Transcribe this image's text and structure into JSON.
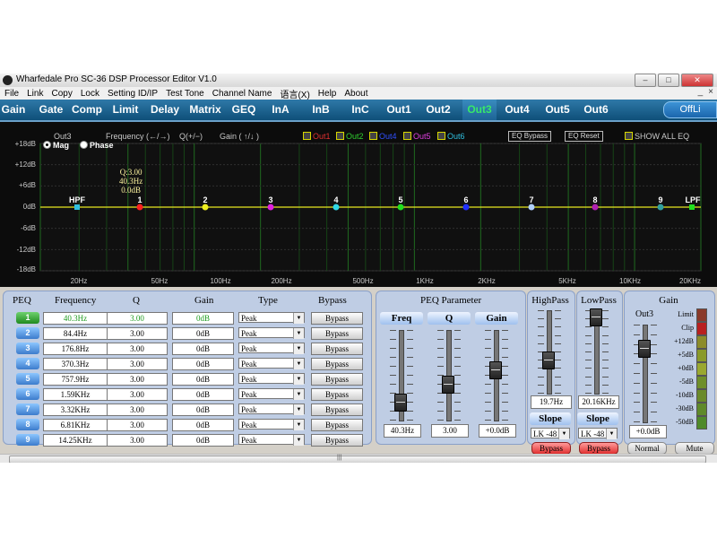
{
  "window": {
    "title": "Wharfedale Pro SC-36 DSP Processor Editor V1.0",
    "buttons": [
      "–",
      "□",
      "✕"
    ],
    "mdi_buttons": [
      "_",
      "×"
    ]
  },
  "menu": [
    "File",
    "Link",
    "Copy",
    "Lock",
    "Setting ID/IP",
    "Test Tone",
    "Channel Name",
    "语言(X)",
    "Help",
    "About"
  ],
  "tabs": [
    "Gain",
    "Gate",
    "Comp",
    "Limit",
    "Delay",
    "Matrix",
    "GEQ",
    "InA",
    "InB",
    "InC",
    "Out1",
    "Out2",
    "Out3",
    "Out4",
    "Out5",
    "Out6"
  ],
  "active_tab": "Out3",
  "status_button": "OffLi",
  "graph": {
    "channel": "Out3",
    "hint_frequency": "Frequency  (←/→)",
    "hint_q": "Q(+/−)",
    "hint_gain": "Gain ( ↑/↓ )",
    "legend": [
      {
        "name": "Out1",
        "color": "#e03030"
      },
      {
        "name": "Out2",
        "color": "#30d030"
      },
      {
        "name": "Out4",
        "color": "#3050ff"
      },
      {
        "name": "Out5",
        "color": "#e040e0"
      },
      {
        "name": "Out6",
        "color": "#30c0e0"
      }
    ],
    "eq_bypass": "EQ Bypass",
    "eq_reset": "EQ Reset",
    "show_all_eq": "SHOW ALL EQ",
    "mode_mag": "Mag",
    "mode_phase": "Phase",
    "y_ticks": [
      "+18dB",
      "+12dB",
      "+6dB",
      "0dB",
      "-6dB",
      "-12dB",
      "-18dB"
    ],
    "x_ticks": [
      "20Hz",
      "50Hz",
      "100Hz",
      "200Hz",
      "500Hz",
      "1KHz",
      "2KHz",
      "5KHz",
      "10KHz",
      "20KHz"
    ],
    "q_info": [
      "Q:3.00",
      "40.3Hz",
      "0.0dB"
    ],
    "points": [
      {
        "label": "HPF",
        "color": "#30c0e0"
      },
      {
        "label": "1",
        "color": "#ff2020"
      },
      {
        "label": "2",
        "color": "#f0f020"
      },
      {
        "label": "3",
        "color": "#e020e0"
      },
      {
        "label": "4",
        "color": "#30d8e8"
      },
      {
        "label": "5",
        "color": "#20e020"
      },
      {
        "label": "6",
        "color": "#2030ff"
      },
      {
        "label": "7",
        "color": "#b0d0ff"
      },
      {
        "label": "8",
        "color": "#b020b0"
      },
      {
        "label": "9",
        "color": "#30a0a0"
      },
      {
        "label": "LPF",
        "color": "#20e020"
      }
    ]
  },
  "peq": {
    "headers": [
      "PEQ",
      "Frequency",
      "Q",
      "Gain",
      "Type",
      "Bypass"
    ],
    "rows": [
      {
        "idx": "1",
        "freq": "40.3Hz",
        "q": "3.00",
        "gain": "0dB",
        "type": "Peak",
        "bypass": "Bypass"
      },
      {
        "idx": "2",
        "freq": "84.4Hz",
        "q": "3.00",
        "gain": "0dB",
        "type": "Peak",
        "bypass": "Bypass"
      },
      {
        "idx": "3",
        "freq": "176.8Hz",
        "q": "3.00",
        "gain": "0dB",
        "type": "Peak",
        "bypass": "Bypass"
      },
      {
        "idx": "4",
        "freq": "370.3Hz",
        "q": "3.00",
        "gain": "0dB",
        "type": "Peak",
        "bypass": "Bypass"
      },
      {
        "idx": "5",
        "freq": "757.9Hz",
        "q": "3.00",
        "gain": "0dB",
        "type": "Peak",
        "bypass": "Bypass"
      },
      {
        "idx": "6",
        "freq": "1.59KHz",
        "q": "3.00",
        "gain": "0dB",
        "type": "Peak",
        "bypass": "Bypass"
      },
      {
        "idx": "7",
        "freq": "3.32KHz",
        "q": "3.00",
        "gain": "0dB",
        "type": "Peak",
        "bypass": "Bypass"
      },
      {
        "idx": "8",
        "freq": "6.81KHz",
        "q": "3.00",
        "gain": "0dB",
        "type": "Peak",
        "bypass": "Bypass"
      },
      {
        "idx": "9",
        "freq": "14.25KHz",
        "q": "3.00",
        "gain": "0dB",
        "type": "Peak",
        "bypass": "Bypass"
      }
    ]
  },
  "peq_param": {
    "title": "PEQ Parameter",
    "freq_label": "Freq",
    "q_label": "Q",
    "gain_label": "Gain",
    "freq_value": "40.3Hz",
    "q_value": "3.00",
    "gain_value": "+0.0dB"
  },
  "highpass": {
    "title": "HighPass",
    "value": "19.7Hz",
    "slope_label": "Slope",
    "slope": "LK -48",
    "bypass": "Bypass"
  },
  "lowpass": {
    "title": "LowPass",
    "value": "20.16KHz",
    "slope_label": "Slope",
    "slope": "LK -48",
    "bypass": "Bypass"
  },
  "gain": {
    "title": "Gain",
    "channel": "Out3",
    "value": "+0.0dB",
    "normal": "Normal",
    "mute": "Mute",
    "meter_labels": [
      "Limit",
      "Clip",
      "+12dB",
      "+5dB",
      "+0dB",
      "-5dB",
      "-10dB",
      "-30dB",
      "-50dB"
    ]
  }
}
